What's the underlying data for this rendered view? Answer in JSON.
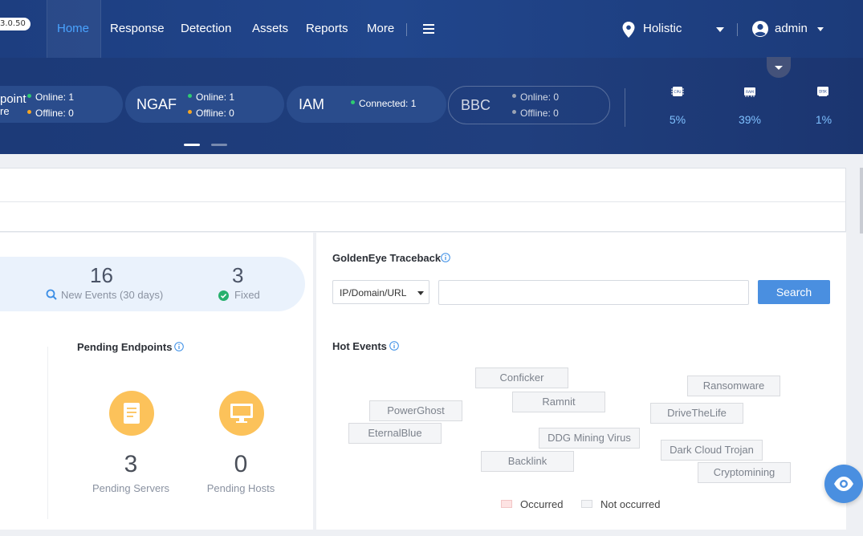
{
  "app": {
    "version_badge": "3.0.50"
  },
  "nav": {
    "items": [
      {
        "label": "Home",
        "active": true
      },
      {
        "label": "Response"
      },
      {
        "label": "Detection"
      },
      {
        "label": "Assets"
      },
      {
        "label": "Reports"
      },
      {
        "label": "More"
      }
    ],
    "location": "Holistic",
    "user": "admin"
  },
  "devices": [
    {
      "name_line1": "point",
      "name_line2": "re",
      "line1": "Online: 1",
      "line2": "Offline: 0",
      "dot1": "#2ecc71",
      "dot2": "#f5a623"
    },
    {
      "name": "NGAF",
      "line1": "Online: 1",
      "line2": "Offline: 0",
      "dot1": "#2ecc71",
      "dot2": "#f5a623"
    },
    {
      "name": "IAM",
      "line1": "Connected: 1",
      "dot1": "#2ecc71"
    },
    {
      "name": "BBC",
      "line1": "Online: 0",
      "line2": "Offline: 0",
      "dot1": "#9aa3b3",
      "dot2": "#9aa3b3"
    }
  ],
  "metrics": [
    {
      "icon": "cpu-icon",
      "label": "CPU",
      "value": "5%"
    },
    {
      "icon": "ram-icon",
      "label": "RAM",
      "value": "39%"
    },
    {
      "icon": "disk-icon",
      "label": "DISK",
      "value": "1%"
    }
  ],
  "stats": {
    "new_events": {
      "value": "16",
      "label": "New Events (30 days)"
    },
    "fixed": {
      "value": "3",
      "label": "Fixed"
    }
  },
  "pending": {
    "title": "Pending Endpoints",
    "servers": {
      "value": "3",
      "label": "Pending Servers"
    },
    "hosts": {
      "value": "0",
      "label": "Pending Hosts"
    }
  },
  "traceback": {
    "title": "GoldenEye Traceback",
    "select_value": "IP/Domain/URL",
    "input_value": "",
    "search_label": "Search"
  },
  "hot_events": {
    "title": "Hot Events",
    "tags": [
      "Conficker",
      "Ransomware",
      "PowerGhost",
      "Ramnit",
      "DriveTheLife",
      "EternalBlue",
      "DDG Mining Virus",
      "Dark Cloud Trojan",
      "Backlink",
      "Cryptomining"
    ],
    "legend": {
      "occurred": "Occurred",
      "not_occurred": "Not occurred"
    },
    "colors": {
      "occurred": "#fde3e3",
      "not_occurred": "#f4f5f7"
    }
  },
  "colors": {
    "accent": "#4a8fe0",
    "nav_active": "#4aa3ff",
    "pending_icon_bg": "#fcc25a"
  }
}
